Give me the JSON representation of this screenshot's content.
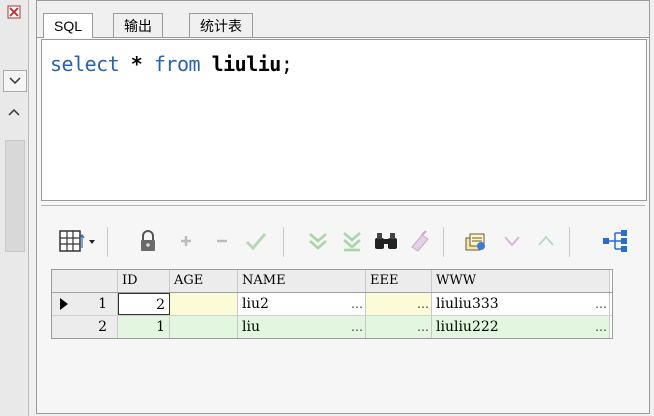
{
  "tabs": [
    {
      "label": "SQL",
      "active": true
    },
    {
      "label": "输出",
      "active": false
    },
    {
      "label": "统计表",
      "active": false
    }
  ],
  "sql": {
    "kw_select": "select",
    "star": " * ",
    "kw_from": "from",
    "table": " liuliu",
    "semicolon": ";"
  },
  "grid": {
    "columns": [
      "ID",
      "AGE",
      "NAME",
      "EEE",
      "WWW"
    ],
    "rows": [
      {
        "row_num": "1",
        "ID": "2",
        "AGE": "",
        "NAME": "liu2",
        "EEE": "",
        "WWW": "liuliu333",
        "current": true
      },
      {
        "row_num": "2",
        "ID": "1",
        "AGE": "",
        "NAME": "liu",
        "EEE": "",
        "WWW": "liuliu222",
        "current": false
      }
    ],
    "ellipsis": "…"
  },
  "colors": {
    "keyword": "#2563b8",
    "row_green": "#e3f7e0",
    "age_yellow": "#fbfbd8",
    "eee_yellow": "#fbfbd8"
  },
  "icons": {
    "grid": "grid-select-icon",
    "lock": "lock-icon",
    "add": "add-record-icon",
    "delete": "delete-record-icon",
    "post": "post-changes-icon",
    "fetch_next": "fetch-next-icon",
    "fetch_all": "fetch-all-icon",
    "find": "binoculars-icon",
    "clear": "clear-icon",
    "export": "export-icon",
    "next": "next-record-icon",
    "prev": "previous-record-icon",
    "tree": "tree-view-icon"
  }
}
